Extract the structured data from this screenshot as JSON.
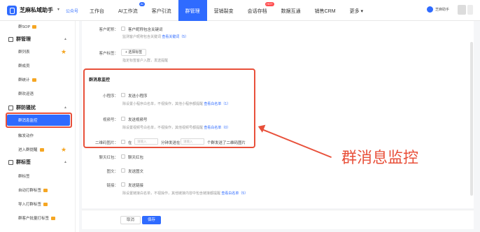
{
  "app": {
    "title": "芝麻私域助手",
    "account": "公众号"
  },
  "nav": [
    {
      "label": "工作台",
      "badge": ""
    },
    {
      "label": "AI工作流",
      "badge": "AI"
    },
    {
      "label": "客户引流",
      "badge": ""
    },
    {
      "label": "群管理",
      "badge": ""
    },
    {
      "label": "营销裂变",
      "badge": ""
    },
    {
      "label": "会话存档",
      "badge": "HOT"
    },
    {
      "label": "数据互通",
      "badge": ""
    },
    {
      "label": "销售CRM",
      "badge": ""
    },
    {
      "label": "更多",
      "badge": ""
    }
  ],
  "user": {
    "name": "芝麻助手"
  },
  "sidebar": {
    "items": [
      {
        "label": "群SOP",
        "type": "item"
      },
      {
        "label": "群管理",
        "type": "group"
      },
      {
        "label": "群列表",
        "type": "item"
      },
      {
        "label": "群成员",
        "type": "item"
      },
      {
        "label": "群统计",
        "type": "item"
      },
      {
        "label": "群欢迎语",
        "type": "item"
      },
      {
        "label": "群防骚扰",
        "type": "group"
      },
      {
        "label": "群消息监控",
        "type": "item"
      },
      {
        "label": "触发动作",
        "type": "item"
      },
      {
        "label": "进入群提醒",
        "type": "item"
      },
      {
        "label": "群标签",
        "type": "group"
      },
      {
        "label": "群标签",
        "type": "item"
      },
      {
        "label": "自动打群标签",
        "type": "item"
      },
      {
        "label": "导入打群标签",
        "type": "item"
      },
      {
        "label": "群客户批量打标签",
        "type": "item"
      }
    ]
  },
  "form": {
    "nickname": {
      "label": "客户昵称：",
      "option": "客户昵称包含关键词",
      "hint": "监测客户昵称包含关键词",
      "link": "查看关键词（5）"
    },
    "tags": {
      "label": "客户标签：",
      "button": "+ 选择标签",
      "hint": "指定标签客户入群，发送提醒"
    },
    "monitor": {
      "title": "群消息监控",
      "mini": {
        "label": "小程序：",
        "option": "发送小程序",
        "hint": "除设置小程序白名单，不视操作，其他小程序都提醒",
        "link": "查看白名单（1）"
      },
      "video": {
        "label": "视频号：",
        "option": "发送视频号",
        "hint": "除设置视频号白名单，不视操作，其他视频号都提醒",
        "link": "查看白名单（0）"
      },
      "qrcode": {
        "label": "二维码图片：",
        "prefix": "在",
        "input1": "请输入",
        "middle": "分钟发送在",
        "input2": "请输入",
        "suffix": "个群发送了二维码图片"
      }
    },
    "redpacket": {
      "label": "聊天红包：",
      "option": "聊天红包"
    },
    "image": {
      "label": "图文：",
      "option": "发送图文"
    },
    "link": {
      "label": "链接：",
      "option": "发送链接",
      "hint": "除设置链接白名单，不视操作，其他链接内容中包含链接都提醒",
      "link": "查看白名单（5）"
    }
  },
  "annotation": "群消息监控",
  "footer": {
    "cancel": "取消",
    "save": "保存"
  },
  "colors": {
    "accent": "#2f6bff",
    "highlight": "#e8503a"
  }
}
